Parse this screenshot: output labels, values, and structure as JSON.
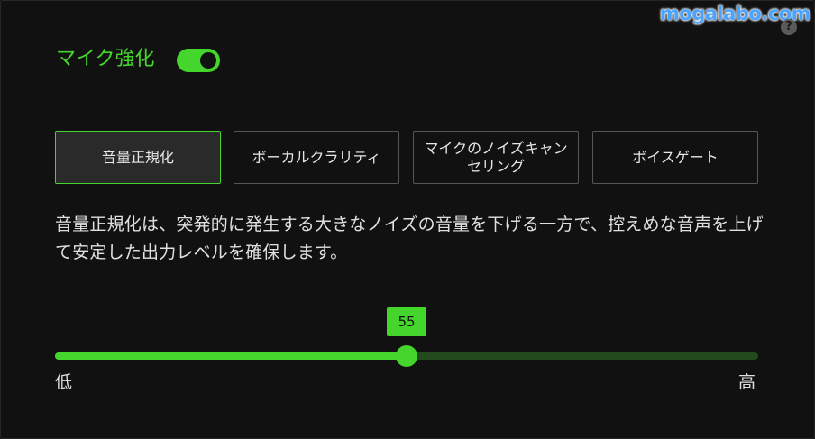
{
  "watermark": "mogalabo.com",
  "help": {
    "icon": "question-icon",
    "glyph": "?"
  },
  "header": {
    "title": "マイク強化",
    "toggle_on": true
  },
  "tabs": [
    {
      "label": "音量正規化",
      "active": true
    },
    {
      "label": "ボーカルクラリティ",
      "active": false
    },
    {
      "label": "マイクのノイズキャンセリング",
      "active": false
    },
    {
      "label": "ボイスゲート",
      "active": false
    }
  ],
  "description": "音量正規化は、突発的に発生する大きなノイズの音量を下げる一方で、控えめな音声を上げて安定した出力レベルを確保します。",
  "slider": {
    "value": 55,
    "value_label": "55",
    "fraction": 0.5,
    "low_label": "低",
    "high_label": "高"
  },
  "colors": {
    "accent": "#44d62c",
    "background": "#111111",
    "track_inactive": "#224a1c",
    "text": "#e0e0e0"
  }
}
